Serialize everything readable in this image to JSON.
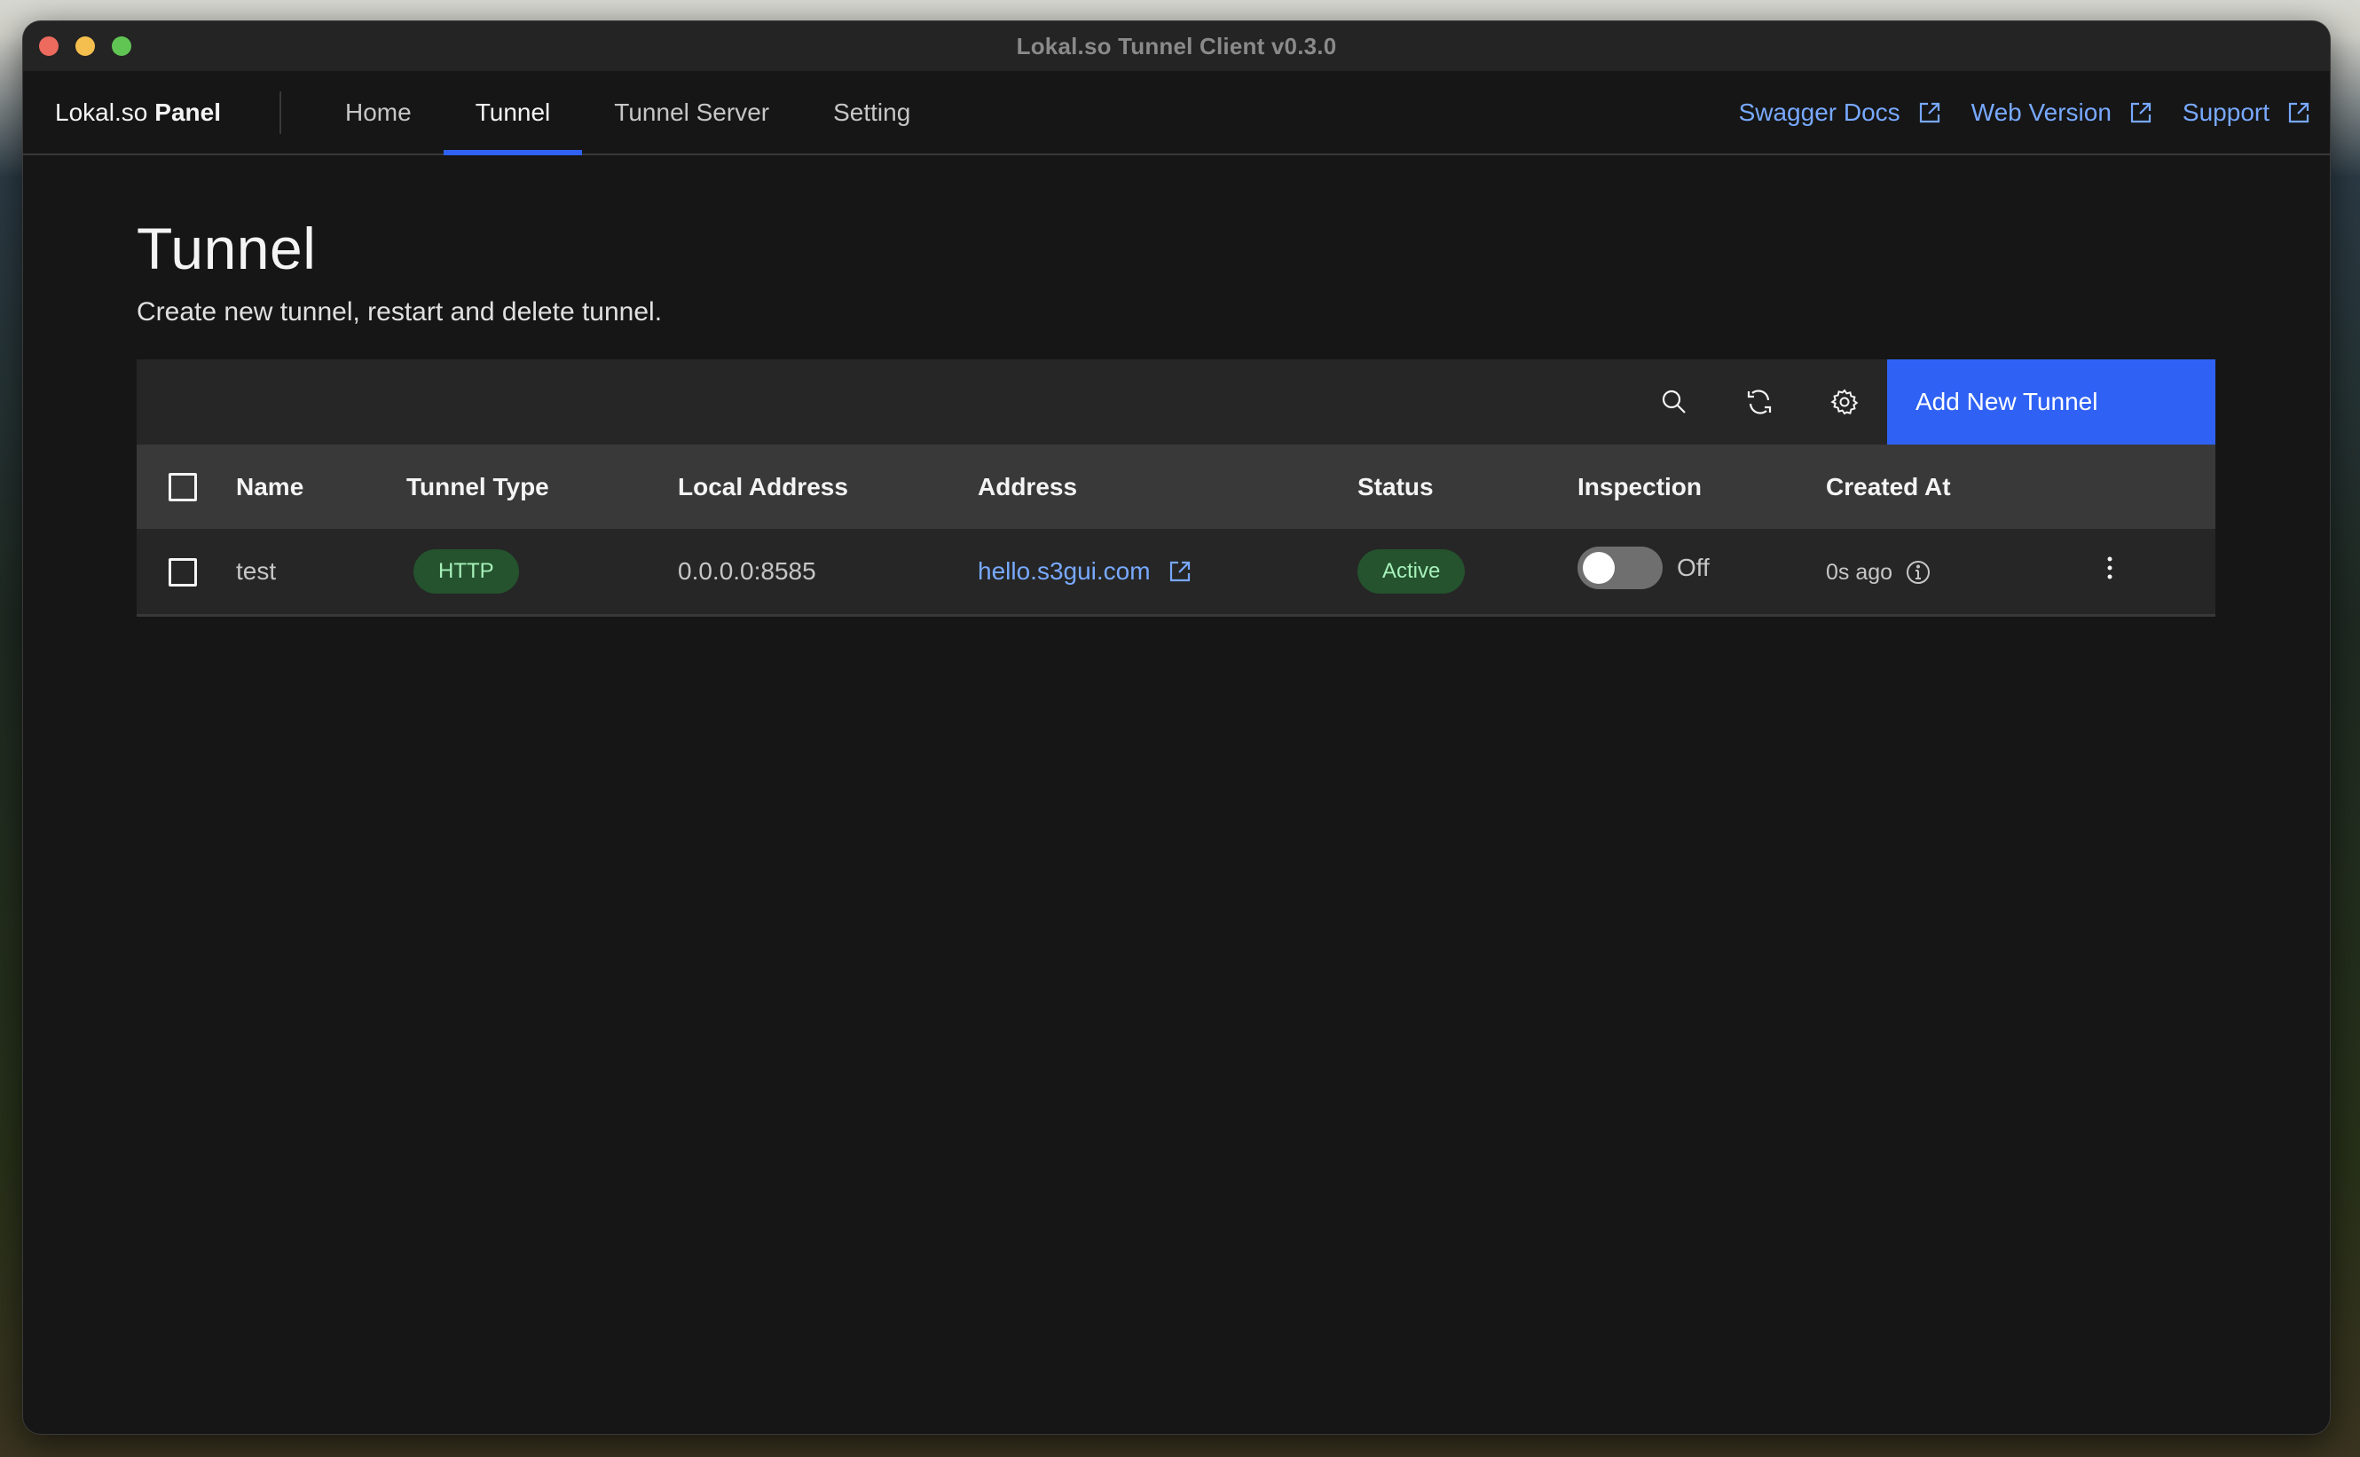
{
  "window": {
    "title": "Lokal.so Tunnel Client v0.3.0"
  },
  "nav": {
    "brand_prefix": "Lokal.so",
    "brand_bold": "Panel",
    "tabs": [
      {
        "label": "Home",
        "active": false
      },
      {
        "label": "Tunnel",
        "active": true
      },
      {
        "label": "Tunnel Server",
        "active": false
      },
      {
        "label": "Setting",
        "active": false
      }
    ],
    "links": [
      {
        "label": "Swagger Docs",
        "icon": "external-link-icon"
      },
      {
        "label": "Web Version",
        "icon": "external-link-icon"
      },
      {
        "label": "Support",
        "icon": "external-link-icon"
      }
    ]
  },
  "page": {
    "title": "Tunnel",
    "subtitle": "Create new tunnel, restart and delete tunnel."
  },
  "toolbar": {
    "icons": [
      "search-icon",
      "refresh-icon",
      "settings-icon"
    ],
    "add_label": "Add New Tunnel"
  },
  "table": {
    "columns": [
      "Name",
      "Tunnel Type",
      "Local Address",
      "Address",
      "Status",
      "Inspection",
      "Created At"
    ],
    "rows": [
      {
        "name": "test",
        "tunnel_type": "HTTP",
        "local_address": "0.0.0.0:8585",
        "address": "hello.s3gui.com",
        "status": "Active",
        "inspection": "Off",
        "inspection_enabled": false,
        "created_at": "0s ago",
        "selected": false
      }
    ]
  },
  "colors": {
    "accent": "#2f62f4",
    "link": "#78a9ff",
    "success_bg": "#24532d",
    "success_fg": "#a7f0ba"
  }
}
